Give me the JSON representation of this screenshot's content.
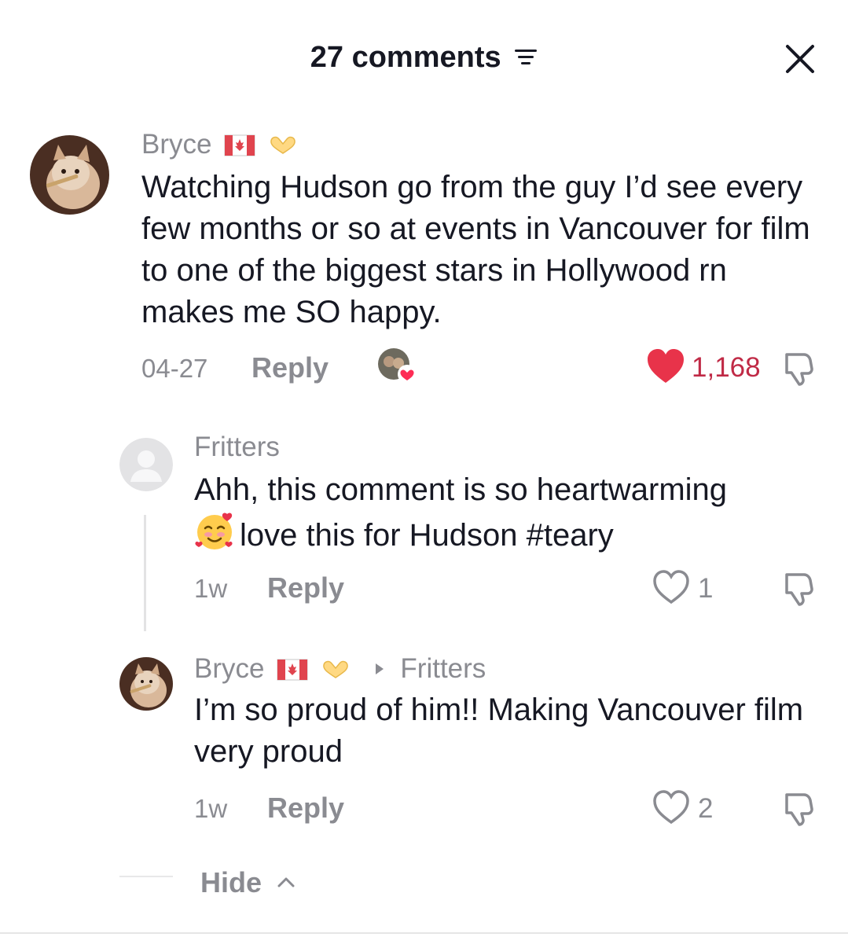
{
  "header": {
    "title": "27 comments",
    "filter_icon": "filter-lines-icon",
    "close_icon": "close-x-icon"
  },
  "colors": {
    "text": "#161823",
    "muted": "#8a8b91",
    "like_red": "#fe2c55",
    "liked_count": "#c02a46",
    "divider": "#e3e3e4"
  },
  "comments": [
    {
      "username": "Bryce",
      "username_icons": [
        "canada-flag-icon",
        "heart-hands-icon"
      ],
      "text": "Watching Hudson go from the guy I’d see every few months or so at events in Vancouver for film to one of the biggest stars in Hollywood rn makes me SO happy.",
      "date": "04-27",
      "reply_label": "Reply",
      "creator_liked_icon": "creator-liked-avatar-icon",
      "likes": "1,168",
      "liked": true
    },
    {
      "username": "Fritters",
      "text": "love this for Hudson #teary",
      "text_first_line": "Ahh, this comment is so heartwarming",
      "emoji": "smiling-face-with-hearts-icon",
      "date": "1w",
      "reply_label": "Reply",
      "likes": "1",
      "liked": false
    },
    {
      "username": "Bryce",
      "reply_to": "Fritters",
      "text": "I’m so proud of him!! Making Vancouver film very proud",
      "date": "1w",
      "reply_label": "Reply",
      "likes": "2",
      "liked": false
    }
  ],
  "hide_label": "Hide"
}
